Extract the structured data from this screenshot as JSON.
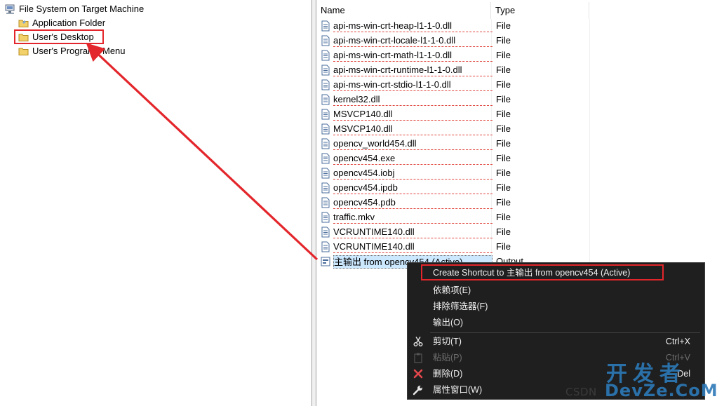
{
  "tree": {
    "root_label": "File System on Target Machine",
    "items": [
      {
        "label": "Application Folder"
      },
      {
        "label": "User's Desktop"
      },
      {
        "label": "User's Programs Menu"
      }
    ]
  },
  "list": {
    "columns": {
      "name": "Name",
      "type": "Type"
    },
    "rows": [
      {
        "name": "api-ms-win-crt-heap-l1-1-0.dll",
        "type": "File"
      },
      {
        "name": "api-ms-win-crt-locale-l1-1-0.dll",
        "type": "File"
      },
      {
        "name": "api-ms-win-crt-math-l1-1-0.dll",
        "type": "File"
      },
      {
        "name": "api-ms-win-crt-runtime-l1-1-0.dll",
        "type": "File"
      },
      {
        "name": "api-ms-win-crt-stdio-l1-1-0.dll",
        "type": "File"
      },
      {
        "name": "kernel32.dll",
        "type": "File"
      },
      {
        "name": "MSVCP140.dll",
        "type": "File"
      },
      {
        "name": "MSVCP140.dll",
        "type": "File"
      },
      {
        "name": "opencv_world454.dll",
        "type": "File"
      },
      {
        "name": "opencv454.exe",
        "type": "File"
      },
      {
        "name": "opencv454.iobj",
        "type": "File"
      },
      {
        "name": "opencv454.ipdb",
        "type": "File"
      },
      {
        "name": "opencv454.pdb",
        "type": "File"
      },
      {
        "name": "traffic.mkv",
        "type": "File"
      },
      {
        "name": "VCRUNTIME140.dll",
        "type": "File"
      },
      {
        "name": "VCRUNTIME140.dll",
        "type": "File"
      },
      {
        "name": "主输出 from opencv454 (Active)",
        "type": "Output"
      }
    ]
  },
  "context_menu": {
    "items": [
      {
        "label": "Create Shortcut to 主输出 from opencv454 (Active)",
        "shortcut": ""
      },
      {
        "label": "依赖项(E)",
        "shortcut": ""
      },
      {
        "label": "排除筛选器(F)",
        "shortcut": ""
      },
      {
        "label": "输出(O)",
        "shortcut": ""
      },
      {
        "label": "剪切(T)",
        "shortcut": "Ctrl+X",
        "icon": "scissors-icon"
      },
      {
        "label": "粘贴(P)",
        "shortcut": "Ctrl+V",
        "icon": "paste-icon",
        "disabled": true
      },
      {
        "label": "删除(D)",
        "shortcut": "Del",
        "icon": "delete-x-icon"
      },
      {
        "label": "属性窗口(W)",
        "shortcut": "",
        "icon": "wrench-icon"
      }
    ]
  },
  "watermark": {
    "csdn": "CSDN",
    "big": "开发者",
    "sub": "DevZe.CoM"
  },
  "colors": {
    "annotation_red": "#e3262b",
    "menu_bg": "#1f1f1f",
    "selection": "#cce8ff",
    "watermark_blue": "#2d7ab8"
  }
}
